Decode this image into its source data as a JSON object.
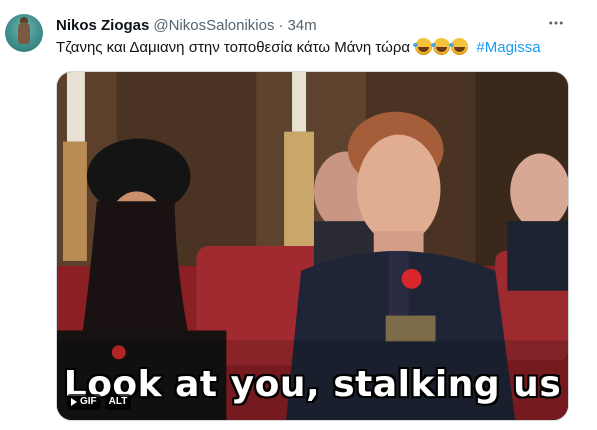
{
  "tweet": {
    "display_name": "Nikos Ziogas",
    "handle": "@NikosSalonikios",
    "separator": "·",
    "time": "34m",
    "more_icon": "more-horizontal-icon",
    "text": "Τζανης και Δαμιανη στην τοποθεσία κάτω Μάνη τώρα",
    "emoji_count": 3,
    "emoji_icon": "rolling-on-floor-laughing-emoji",
    "hashtag": "#Magissa",
    "hashtag_color": "#1d9bf0"
  },
  "media": {
    "caption": "Look at you, stalking us",
    "badges": {
      "gif": "GIF",
      "alt": "ALT"
    }
  },
  "colors": {
    "text": "#0f1419",
    "secondary": "#536471",
    "border": "#cfd9de"
  }
}
